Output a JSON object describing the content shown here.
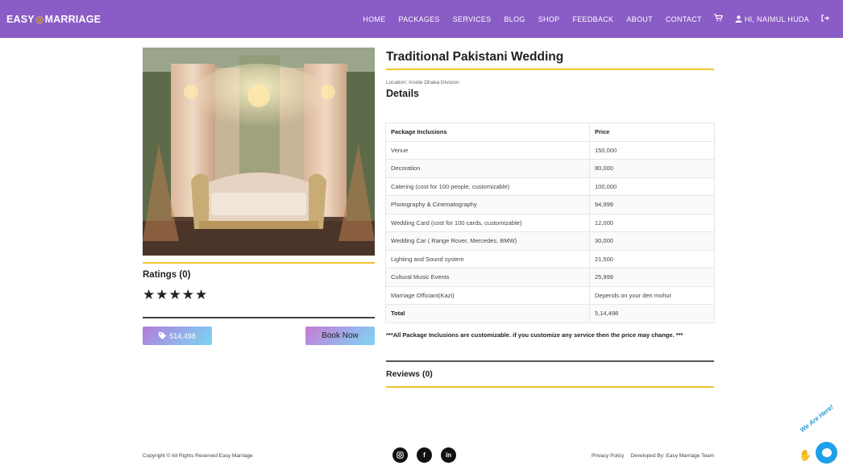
{
  "nav": {
    "brand_left": "EASY",
    "brand_right": "MARRIAGE",
    "links": [
      "HOME",
      "PACKAGES",
      "SERVICES",
      "BLOG",
      "SHOP",
      "FEEDBACK",
      "ABOUT",
      "CONTACT"
    ],
    "user_label": "HI, NAIMUL HUDA",
    "icons": [
      "cart-icon",
      "user-icon",
      "logout-icon"
    ]
  },
  "left": {
    "ratings_label": "Ratings (0)",
    "stars": "★★★★★",
    "price_label": "514,498",
    "book_label": "Book Now"
  },
  "package": {
    "title": "Traditional Pakistani Wedding",
    "location": "Location: Inside Dhaka Division",
    "details_label": "Details",
    "table_headers": [
      "Package Inclusions",
      "Price"
    ],
    "rows": [
      {
        "item": "Venue",
        "price": "150,000"
      },
      {
        "item": "Decoration",
        "price": "80,000"
      },
      {
        "item": "Catering (cost for 100 people, customizable)",
        "price": "100,000"
      },
      {
        "item": "Photography & Cinematography",
        "price": "94,999"
      },
      {
        "item": "Wedding Card (cost for 100 cards, customizable)",
        "price": "12,000"
      },
      {
        "item": "Wedding Car ( Range Rover, Mercedes, BMW)",
        "price": "30,000"
      },
      {
        "item": "Lighting and Sound system",
        "price": "21,500"
      },
      {
        "item": "Cultural Music Events",
        "price": "25,999"
      },
      {
        "item": "Marriage Officiant(Kazi)",
        "price": "Depends on your den mohur"
      }
    ],
    "total_label": "Total",
    "total_value": "5,14,498",
    "note": "***All Package Inclusions are customizable. if you customize any service then the price may change. ***",
    "reviews_label": "Reviews (0)"
  },
  "footer": {
    "copyright": "Copyright © All Rights Reserved Easy Marriage",
    "socials": [
      "instagram-icon",
      "facebook-icon",
      "linkedin-icon"
    ],
    "privacy": "Privacy Policy",
    "developed_by": "Developed By: Easy Marriage Team"
  },
  "chat": {
    "label": "We Are Here!"
  },
  "colors": {
    "nav_bg": "#8a5cc6",
    "accent_gold": "#f2c230",
    "chat_blue": "#1da0e8"
  }
}
